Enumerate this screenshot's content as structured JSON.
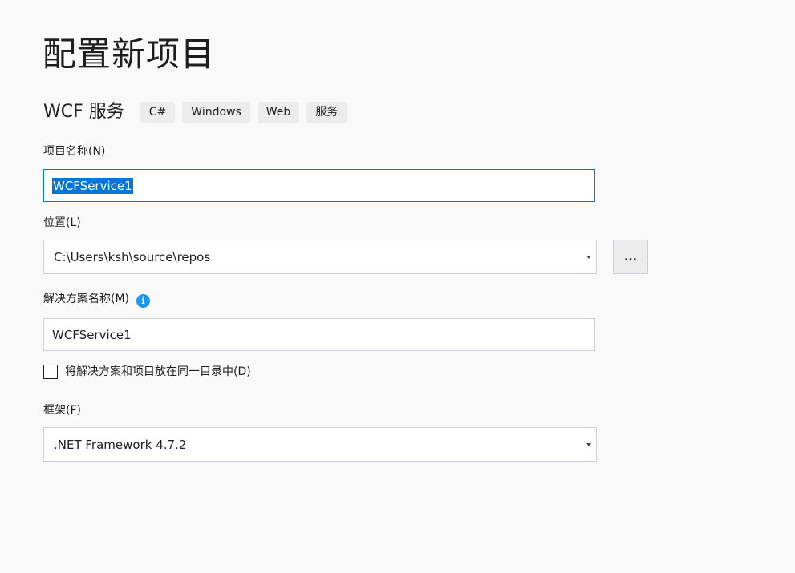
{
  "page": {
    "title": "配置新项目"
  },
  "template": {
    "name": "WCF 服务",
    "tags": [
      "C#",
      "Windows",
      "Web",
      "服务"
    ]
  },
  "project_name": {
    "label": "项目名称(N)",
    "value": "WCFService1"
  },
  "location": {
    "label": "位置(L)",
    "value": "C:\\Users\\ksh\\source\\repos",
    "browse_label": "..."
  },
  "solution_name": {
    "label": "解决方案名称(M)",
    "value": "WCFService1",
    "info_icon": "info-icon"
  },
  "same_directory": {
    "label": "将解决方案和项目放在同一目录中(D)",
    "checked": false
  },
  "framework": {
    "label": "框架(F)",
    "value": ".NET Framework 4.7.2"
  },
  "colors": {
    "background": "#f9f9f9",
    "focus_border": "#007acc",
    "selection": "#0078d7",
    "info": "#1c97ea"
  }
}
